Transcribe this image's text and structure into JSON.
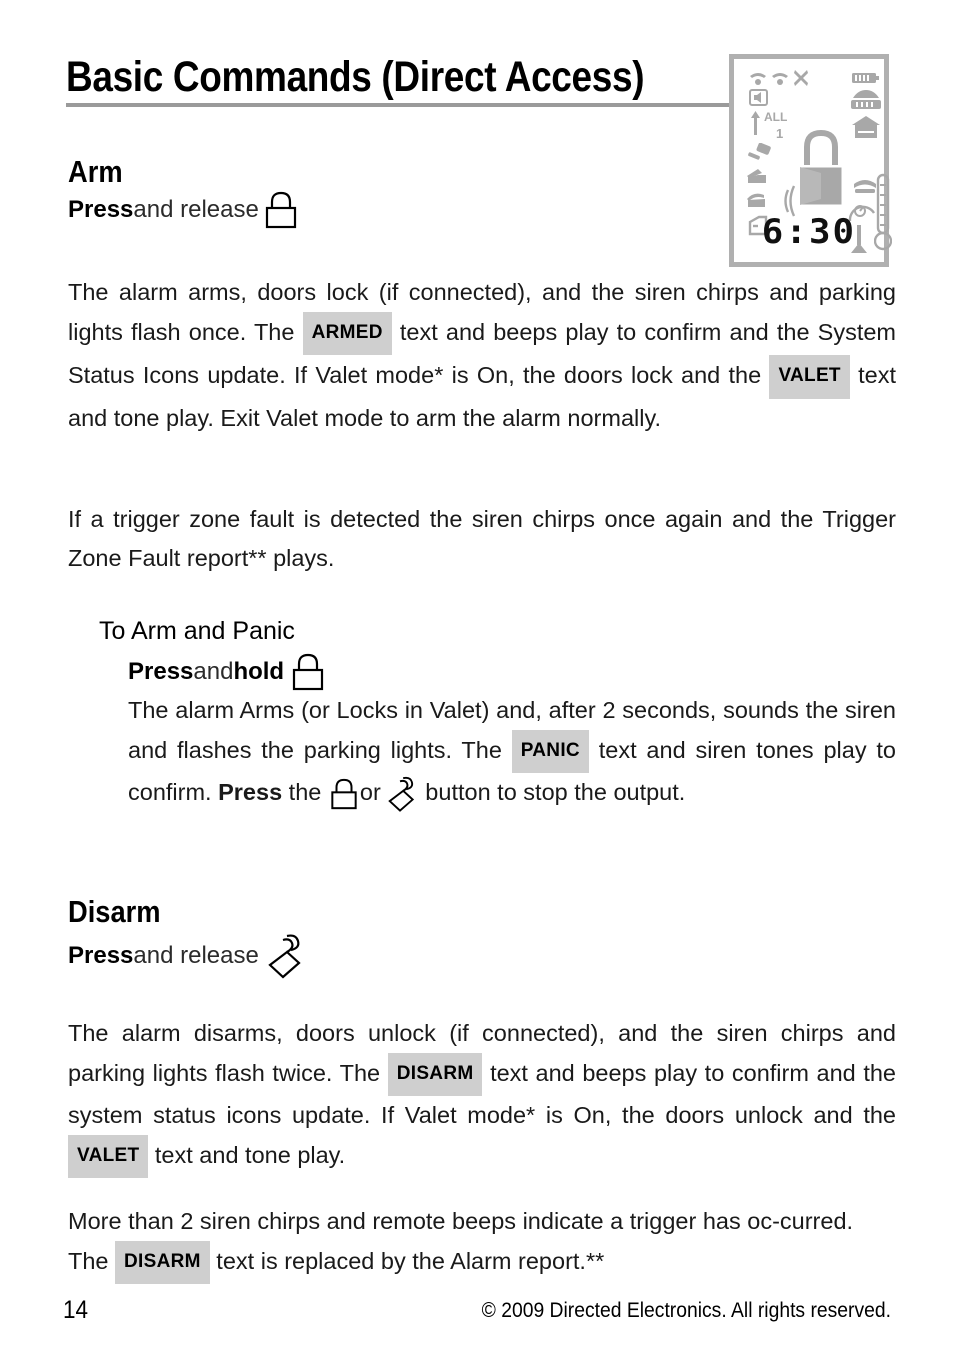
{
  "document": {
    "title": "Basic Commands (Direct Access)",
    "page_number": "14",
    "copyright": "© 2009 Directed Electronics. All rights reserved."
  },
  "lcd_display": {
    "name": "remote-lcd-display",
    "time": "6:30",
    "labels": {
      "all": "ALL",
      "channel": "1"
    },
    "icon_color": "#a8a8a8",
    "frame_color": "#b0b0b0",
    "icons": [
      "antenna-signal-icon",
      "antenna-signal-alt-icon",
      "no-signal-x-icon",
      "speaker-icon",
      "up-arrow-icon",
      "impact-sensor-icon",
      "car-trunk-icon",
      "car-hood-icon",
      "car-door-icon",
      "padlock-icon",
      "sound-wave-icon",
      "remote-vibrate-icon",
      "battery-icon",
      "car-front-icon",
      "garage-home-icon",
      "seat-heater-icon",
      "tachometer-icon",
      "thermometer-icon"
    ]
  },
  "sections": {
    "arm": {
      "heading": "Arm",
      "action_press": "Press",
      "action_rest": " and release ",
      "action_icon": "lock-icon",
      "paragraph_1": {
        "part_1": "The alarm arms, doors lock (if connected), and the siren chirps and parking lights flash once. The ",
        "badge_1": "ARMED",
        "part_2": " text and beeps play to confirm and the System Status Icons update. If Valet mode* is On, the doors lock and the ",
        "badge_2": "VALET",
        "part_3": " text and tone play. Exit Valet mode to arm the alarm normally."
      },
      "paragraph_2": "If a trigger zone fault is detected the siren chirps once again and the Trigger Zone Fault report** plays.",
      "panic": {
        "heading": "To Arm and Panic",
        "action_press": "Press",
        "action_mid": " and ",
        "action_hold": "hold",
        "action_icon": "lock-icon",
        "body_part_1": "The alarm Arms (or Locks in Valet) and, after 2 seconds, sounds the siren and flashes the parking lights. The ",
        "badge_1": "PANIC",
        "body_part_2": " text and siren tones play to confirm. ",
        "body_press": "Press",
        "body_part_3": " the ",
        "icon_lock": "lock-icon",
        "body_or": "or",
        "icon_unlock": "unlock-icon",
        "body_part_4": " button to stop the output."
      }
    },
    "disarm": {
      "heading": "Disarm",
      "action_press": "Press",
      "action_rest": " and release ",
      "action_icon": "unlock-icon",
      "paragraph_1": {
        "part_1": "The alarm disarms, doors unlock (if connected), and the siren chirps and parking lights flash twice. The ",
        "badge_1": "DISARM",
        "part_2": " text and beeps play to confirm and the system status icons update. If Valet mode* is On, the doors unlock and the ",
        "badge_2": "VALET",
        "part_3": " text and tone play."
      },
      "paragraph_2": {
        "part_1": "More than 2 siren chirps and remote beeps indicate a trigger has oc-curred. The ",
        "badge_1": "DISARM",
        "part_2": " text is replaced by the Alarm report.**"
      }
    }
  }
}
